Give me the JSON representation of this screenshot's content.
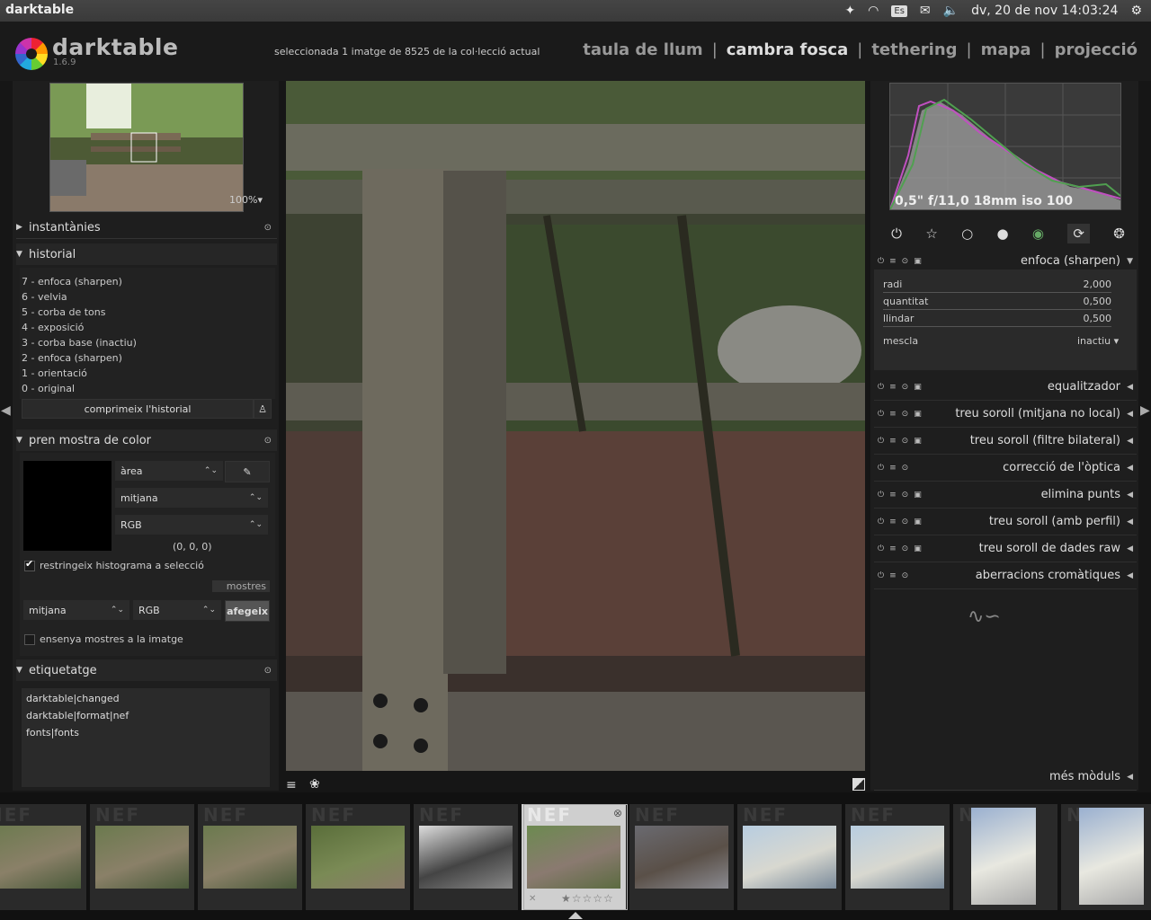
{
  "system": {
    "app_name": "darktable",
    "lang": "Es",
    "datetime": "dv, 20 de nov 14:03:24"
  },
  "header": {
    "logo": "darktable",
    "version": "1.6.9",
    "status": "seleccionada 1 imatge de 8525 de la col·lecció actual",
    "views": [
      "taula de llum",
      "cambra fosca",
      "tethering",
      "mapa",
      "projecció"
    ],
    "active_view": "cambra fosca"
  },
  "navigation": {
    "zoom": "100%"
  },
  "left": {
    "snapshots": "instantànies",
    "history_title": "historial",
    "history": [
      "7 - enfoca (sharpen)",
      "6 - velvia",
      "5 - corba de tons",
      "4 - exposició",
      "3 - corba base (inactiu)",
      "2 - enfoca (sharpen)",
      "1 - orientació",
      "0 - original"
    ],
    "compress_button": "comprimeix l'historial",
    "colorpicker_title": "pren mostra de color",
    "picker_mode": "àrea",
    "picker_stat": "mitjana",
    "picker_space": "RGB",
    "picker_value": "(0, 0, 0)",
    "restrict_label": "restringeix histograma a selecció",
    "samples_label": "mostres",
    "sample_stat": "mitjana",
    "sample_space": "RGB",
    "add_button": "afegeix",
    "show_samples_label": "ensenya mostres a la imatge",
    "tagging_title": "etiquetatge",
    "tags": [
      "darktable|changed",
      "darktable|format|nef",
      "fonts|fonts"
    ]
  },
  "right": {
    "exif": "0,5\" f/11,0 18mm iso 100",
    "active_module": "enfoca (sharpen)",
    "sliders": [
      {
        "label": "radi",
        "value": "2,000"
      },
      {
        "label": "quantitat",
        "value": "0,500"
      },
      {
        "label": "llindar",
        "value": "0,500"
      }
    ],
    "blend_label": "mescla",
    "blend_value": "inactiu",
    "modules": [
      "equalitzador",
      "treu soroll (mitjana no local)",
      "treu soroll (filtre bilateral)",
      "correcció de l'òptica",
      "elimina punts",
      "treu soroll (amb perfil)",
      "treu soroll de dades raw",
      "aberracions cromàtiques"
    ],
    "more_modules": "més mòduls"
  },
  "filmstrip": {
    "watermark": "NEF",
    "thumbs": [
      {
        "colors": [
          "#6b7a4e",
          "#8a8068",
          "#4a5a3a"
        ]
      },
      {
        "colors": [
          "#6b7a4e",
          "#8a8068",
          "#4a5a3a"
        ]
      },
      {
        "colors": [
          "#6b7a4e",
          "#8a8068",
          "#4a5a3a"
        ]
      },
      {
        "colors": [
          "#5a6e3a",
          "#7a8a55",
          "#8a7a6a"
        ]
      },
      {
        "colors": [
          "#dddddd",
          "#444444",
          "#888888"
        ]
      },
      {
        "colors": [
          "#6c8a50",
          "#8a7a70",
          "#5b6b40"
        ]
      },
      {
        "colors": [
          "#6a6a70",
          "#5a5048",
          "#8a8a90"
        ]
      },
      {
        "colors": [
          "#b8cde0",
          "#d8d8d0",
          "#7a8a9a"
        ]
      },
      {
        "colors": [
          "#b8cde0",
          "#d8d8d0",
          "#7a8a9a"
        ]
      },
      {
        "colors": [
          "#9ab0d0",
          "#e8e8e0",
          "#aaaaaa"
        ]
      },
      {
        "colors": [
          "#9ab0d0",
          "#e8e8e0",
          "#aaaaaa"
        ]
      }
    ]
  }
}
